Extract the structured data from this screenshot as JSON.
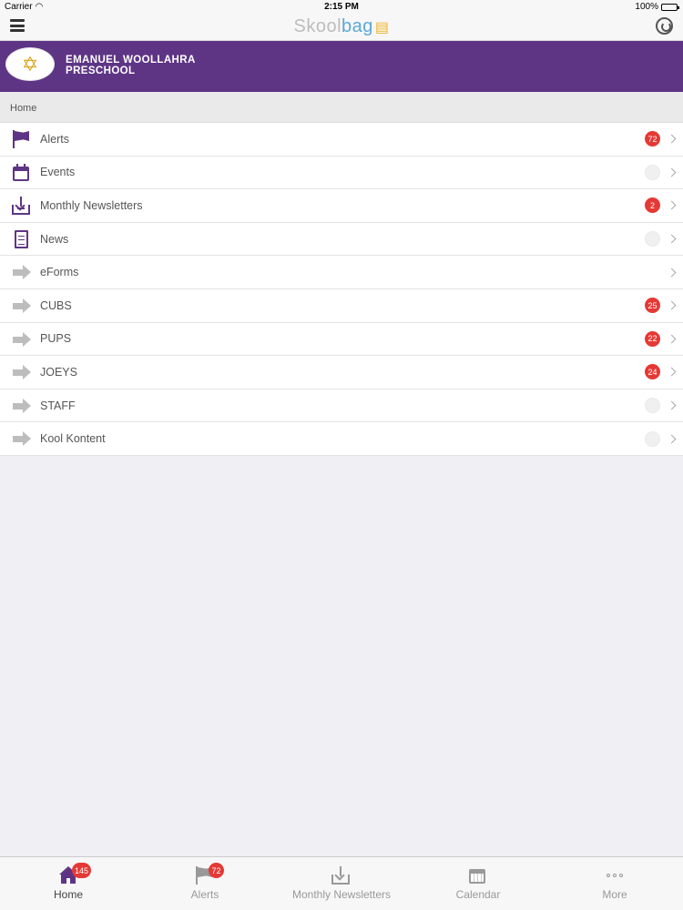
{
  "status_bar": {
    "carrier": "Carrier",
    "time": "2:15 PM",
    "battery": "100%"
  },
  "nav": {
    "logo_part1": "Skool",
    "logo_part2": "bag",
    "logo_part3": "▤"
  },
  "school": {
    "name_line1": "EMANUEL WOOLLAHRA",
    "name_line2": "PRESCHOOL",
    "logo_glyph": "✡"
  },
  "breadcrumb": "Home",
  "menu": [
    {
      "label": "Alerts",
      "icon": "flag-icon",
      "badge": "72"
    },
    {
      "label": "Events",
      "icon": "calendar-icon",
      "badge": ""
    },
    {
      "label": "Monthly Newsletters",
      "icon": "inbox-download-icon",
      "badge": "2"
    },
    {
      "label": "News",
      "icon": "document-icon",
      "badge": ""
    },
    {
      "label": "eForms",
      "icon": "arrow-right-icon",
      "badge": null
    },
    {
      "label": "CUBS",
      "icon": "arrow-right-icon",
      "badge": "25"
    },
    {
      "label": "PUPS",
      "icon": "arrow-right-icon",
      "badge": "22"
    },
    {
      "label": "JOEYS",
      "icon": "arrow-right-icon",
      "badge": "24"
    },
    {
      "label": "STAFF",
      "icon": "arrow-right-icon",
      "badge": ""
    },
    {
      "label": "Kool Kontent",
      "icon": "arrow-right-icon",
      "badge": ""
    }
  ],
  "tabs": [
    {
      "label": "Home",
      "icon": "home-icon",
      "badge": "145",
      "active": true
    },
    {
      "label": "Alerts",
      "icon": "flag-icon",
      "badge": "72",
      "active": false
    },
    {
      "label": "Monthly Newsletters",
      "icon": "inbox-download-icon",
      "badge": null,
      "active": false
    },
    {
      "label": "Calendar",
      "icon": "calendar-icon",
      "badge": null,
      "active": false
    },
    {
      "label": "More",
      "icon": "more-dots-icon",
      "badge": null,
      "active": false
    }
  ],
  "colors": {
    "brand_purple": "#5e3585",
    "badge_red": "#e53935",
    "logo_grey": "#bdbdbd",
    "logo_blue": "#5aa8d8"
  }
}
